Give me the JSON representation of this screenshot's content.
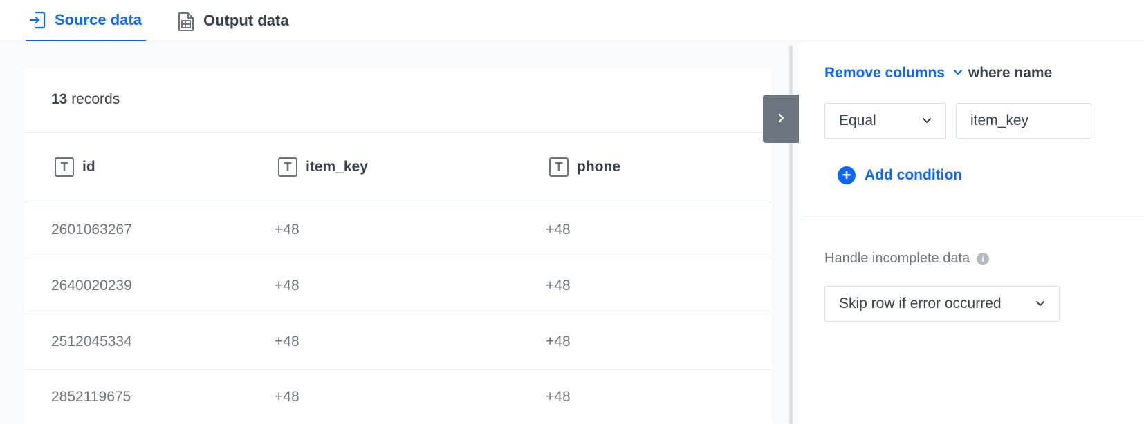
{
  "tabs": [
    {
      "label": "Source data",
      "icon": "import-icon",
      "active": true
    },
    {
      "label": "Output data",
      "icon": "spreadsheet-icon",
      "active": false
    }
  ],
  "table": {
    "record_count": "13",
    "record_suffix": " records",
    "columns": [
      {
        "label": "id",
        "type_icon": "text-type-icon"
      },
      {
        "label": "item_key",
        "type_icon": "text-type-icon"
      },
      {
        "label": "phone",
        "type_icon": "text-type-icon"
      }
    ],
    "rows": [
      [
        "2601063267",
        "+48",
        "+48"
      ],
      [
        "2640020239",
        "+48",
        "+48"
      ],
      [
        "2512045334",
        "+48",
        "+48"
      ],
      [
        "2852119675",
        "+48",
        "+48"
      ]
    ]
  },
  "panel": {
    "action_label": "Remove columns",
    "where_label": "where name",
    "operator": "Equal",
    "value": "item_key",
    "add_condition_label": "Add condition",
    "incomplete_label": "Handle incomplete data",
    "incomplete_option": "Skip row if error occurred"
  },
  "colors": {
    "accent": "#0b68ff",
    "text": "#384350",
    "muted": "#6a7580"
  }
}
